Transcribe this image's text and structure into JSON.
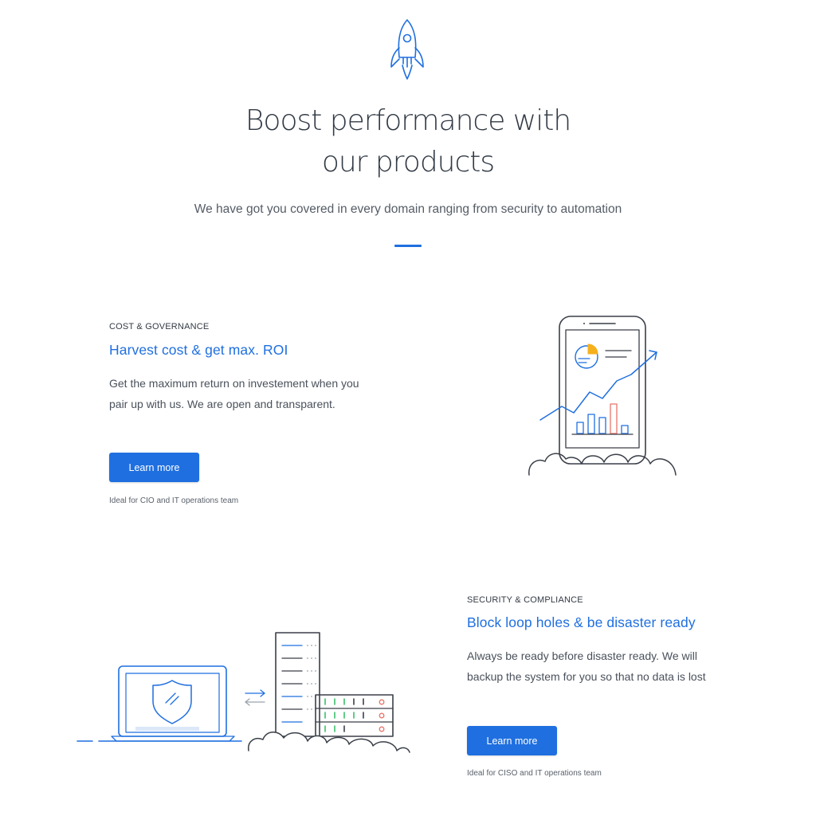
{
  "hero": {
    "title": "Boost performance with\nour products",
    "subtitle": "We have got you covered in every domain ranging from security to automation",
    "icon": "rocket-icon"
  },
  "features": [
    {
      "eyebrow": "COST & GOVERNANCE",
      "title": "Harvest cost & get max. ROI",
      "description": "Get the maximum return on investement when you pair up with us. We are open and transparent.",
      "button_label": "Learn more",
      "ideal_for": "Ideal for CIO and IT operations team",
      "illustration": "phone-growth-chart-illustration"
    },
    {
      "eyebrow": "SECURITY & COMPLIANCE",
      "title": "Block loop holes & be disaster ready",
      "description": "Always be ready before disaster ready. We will backup the system for you so that no data is lost",
      "button_label": "Learn more",
      "ideal_for": "Ideal for CISO and IT operations team",
      "illustration": "laptop-shield-server-illustration"
    }
  ],
  "colors": {
    "accent": "#1f6fe0",
    "text_dark": "#323a45",
    "chart_orange": "#f5b01c",
    "chart_red": "#e8756a",
    "line_gray": "#3a3f48"
  }
}
